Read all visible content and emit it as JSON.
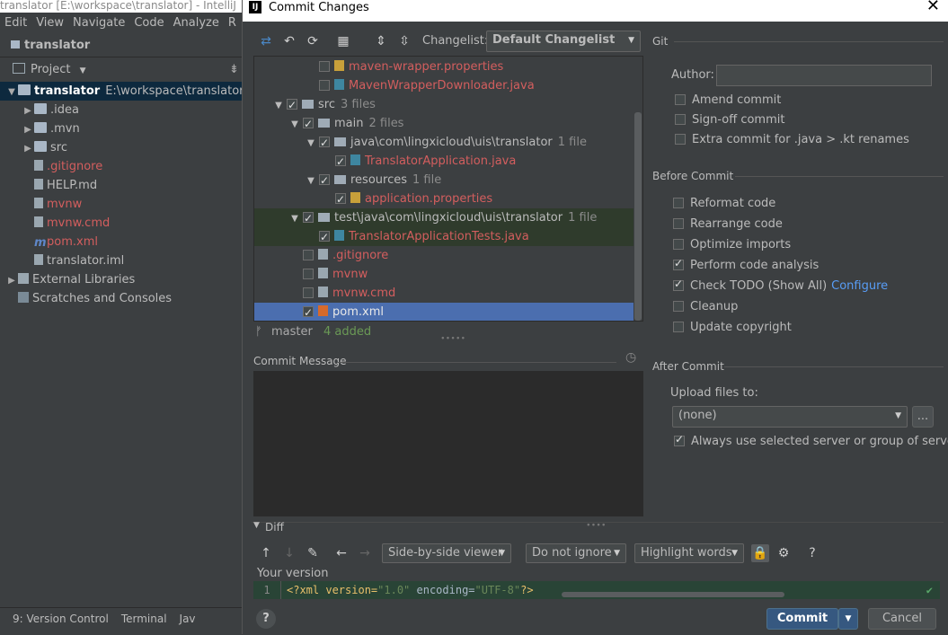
{
  "ide": {
    "window_title": "translator [E:\\workspace\\translator] - IntelliJ",
    "menu": [
      "Edit",
      "View",
      "Navigate",
      "Code",
      "Analyze",
      "R"
    ],
    "nav_root": "translator",
    "project_view": "Project",
    "tree": [
      {
        "name": "translator",
        "extra": "E:\\workspace\\translator",
        "arrow": "▼",
        "indent": 0,
        "kind": "folder",
        "color": "#ffffff"
      },
      {
        "name": ".idea",
        "extra": "",
        "arrow": "▶",
        "indent": 1,
        "kind": "folder",
        "color": "#bbbbbb"
      },
      {
        "name": ".mvn",
        "extra": "",
        "arrow": "▶",
        "indent": 1,
        "kind": "folder",
        "color": "#bbbbbb"
      },
      {
        "name": "src",
        "extra": "",
        "arrow": "▶",
        "indent": 1,
        "kind": "folder",
        "color": "#bbbbbb"
      },
      {
        "name": ".gitignore",
        "extra": "",
        "arrow": "",
        "indent": 1,
        "kind": "file",
        "color": "#d35e5e"
      },
      {
        "name": "HELP.md",
        "extra": "",
        "arrow": "",
        "indent": 1,
        "kind": "file",
        "color": "#bbbbbb"
      },
      {
        "name": "mvnw",
        "extra": "",
        "arrow": "",
        "indent": 1,
        "kind": "file",
        "color": "#d35e5e"
      },
      {
        "name": "mvnw.cmd",
        "extra": "",
        "arrow": "",
        "indent": 1,
        "kind": "file",
        "color": "#d35e5e"
      },
      {
        "name": "pom.xml",
        "extra": "",
        "arrow": "",
        "indent": 1,
        "kind": "maven",
        "color": "#d35e5e"
      },
      {
        "name": "translator.iml",
        "extra": "",
        "arrow": "",
        "indent": 1,
        "kind": "file",
        "color": "#bbbbbb"
      },
      {
        "name": "External Libraries",
        "extra": "",
        "arrow": "▶",
        "indent": 0,
        "kind": "lib",
        "color": "#bbbbbb"
      },
      {
        "name": "Scratches and Consoles",
        "extra": "",
        "arrow": "",
        "indent": 0,
        "kind": "scratch",
        "color": "#bbbbbb"
      }
    ],
    "bottom_tabs": [
      "9: Version Control",
      "Terminal",
      "Jav"
    ]
  },
  "dialog": {
    "title": "Commit Changes",
    "changelist_label": "Changelist:",
    "changelist_value": "Default Changelist",
    "changes": [
      {
        "name": "maven-wrapper.properties",
        "count": "",
        "indent": 4,
        "checked": false,
        "arrow": "",
        "icon": "prop",
        "color": "#d35e5e",
        "row": "plain"
      },
      {
        "name": "MavenWrapperDownloader.java",
        "count": "",
        "indent": 4,
        "checked": false,
        "arrow": "",
        "icon": "java",
        "color": "#d35e5e",
        "row": "plain"
      },
      {
        "name": "src",
        "count": "3 files",
        "indent": 2,
        "checked": true,
        "arrow": "▼",
        "icon": "fold",
        "color": "#bbbbbb",
        "row": "plain"
      },
      {
        "name": "main",
        "count": "2 files",
        "indent": 3,
        "checked": true,
        "arrow": "▼",
        "icon": "fold",
        "color": "#bbbbbb",
        "row": "plain"
      },
      {
        "name": "java\\com\\lingxicloud\\uis\\translator",
        "count": "1 file",
        "indent": 4,
        "checked": true,
        "arrow": "▼",
        "icon": "fold",
        "color": "#bbbbbb",
        "row": "plain"
      },
      {
        "name": "TranslatorApplication.java",
        "count": "",
        "indent": 5,
        "checked": true,
        "arrow": "",
        "icon": "java",
        "color": "#d35e5e",
        "row": "plain"
      },
      {
        "name": "resources",
        "count": "1 file",
        "indent": 4,
        "checked": true,
        "arrow": "▼",
        "icon": "fold",
        "color": "#bbbbbb",
        "row": "plain"
      },
      {
        "name": "application.properties",
        "count": "",
        "indent": 5,
        "checked": true,
        "arrow": "",
        "icon": "prop",
        "color": "#d35e5e",
        "row": "plain"
      },
      {
        "name": "test\\java\\com\\lingxicloud\\uis\\translator",
        "count": "1 file",
        "indent": 3,
        "checked": true,
        "arrow": "▼",
        "icon": "fold",
        "color": "#bbbbbb",
        "row": "green"
      },
      {
        "name": "TranslatorApplicationTests.java",
        "count": "",
        "indent": 4,
        "checked": true,
        "arrow": "",
        "icon": "java",
        "color": "#d35e5e",
        "row": "green"
      },
      {
        "name": ".gitignore",
        "count": "",
        "indent": 3,
        "checked": false,
        "arrow": "",
        "icon": "txt",
        "color": "#d35e5e",
        "row": "plain"
      },
      {
        "name": "mvnw",
        "count": "",
        "indent": 3,
        "checked": false,
        "arrow": "",
        "icon": "txt",
        "color": "#d35e5e",
        "row": "plain"
      },
      {
        "name": "mvnw.cmd",
        "count": "",
        "indent": 3,
        "checked": false,
        "arrow": "",
        "icon": "txt",
        "color": "#d35e5e",
        "row": "plain"
      },
      {
        "name": "pom.xml",
        "count": "",
        "indent": 3,
        "checked": true,
        "arrow": "",
        "icon": "xml",
        "color": "#d35e5e",
        "row": "selected"
      }
    ],
    "branch": "master",
    "added_status": "4 added",
    "commit_message_label": "Commit Message",
    "git": {
      "section": "Git",
      "author_label": "Author:",
      "author_value": "",
      "options": [
        {
          "label": "Amend commit",
          "checked": false,
          "ul": "A"
        },
        {
          "label": "Sign-off commit",
          "checked": false,
          "ul": ""
        },
        {
          "label": "Extra commit for .java > .kt renames",
          "checked": false,
          "ul": ""
        }
      ]
    },
    "before_commit": {
      "section": "Before Commit",
      "options": [
        {
          "label": "Reformat code",
          "checked": false
        },
        {
          "label": "Rearrange code",
          "checked": false
        },
        {
          "label": "Optimize imports",
          "checked": false
        },
        {
          "label": "Perform code analysis",
          "checked": true
        },
        {
          "label": "Check TODO (Show All)",
          "checked": true
        },
        {
          "label": "Cleanup",
          "checked": false
        },
        {
          "label": "Update copyright",
          "checked": false
        }
      ],
      "configure_link": "Configure"
    },
    "after_commit": {
      "section": "After Commit",
      "upload_label": "Upload files to:",
      "upload_value": "(none)",
      "browse_label": "...",
      "always_label": "Always use selected server or group of servers",
      "always_checked": true
    },
    "diff": {
      "section": "Diff",
      "viewer": "Side-by-side viewer",
      "ignore": "Do not ignore",
      "highlight": "Highlight words",
      "help": "?",
      "your_version": "Your version",
      "line_number": "1",
      "code": {
        "open": "<?xml version=",
        "ver": "\"1.0\"",
        "mid": " encoding=",
        "enc": "\"UTF-8\"",
        "close": "?>"
      }
    },
    "buttons": {
      "help": "?",
      "commit": "Commit",
      "cancel": "Cancel"
    }
  }
}
